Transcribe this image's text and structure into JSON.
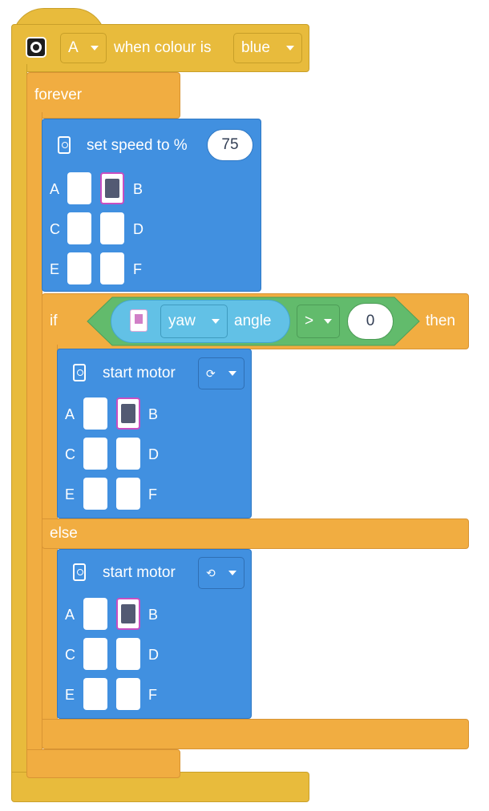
{
  "hat": {
    "port_dropdown": "A",
    "label": "when colour is",
    "colour_dropdown": "blue",
    "sensor_icon": "colour-sensor-icon"
  },
  "forever": {
    "label": "forever"
  },
  "set_speed": {
    "label": "set speed to %",
    "value": "75",
    "icon": "motor-icon",
    "ports": [
      "A",
      "B",
      "C",
      "D",
      "E",
      "F"
    ],
    "selected_port": "B"
  },
  "if_block": {
    "if_label": "if",
    "then_label": "then",
    "else_label": "else",
    "condition": {
      "hub_icon": "hub-icon",
      "axis_dropdown": "yaw",
      "angle_label": "angle",
      "operator_dropdown": ">",
      "compare_value": "0"
    }
  },
  "start_motor_1": {
    "label": "start motor",
    "direction_icon": "clockwise-icon",
    "direction_glyph": "⟳",
    "ports": [
      "A",
      "B",
      "C",
      "D",
      "E",
      "F"
    ],
    "selected_port": "B"
  },
  "start_motor_2": {
    "label": "start motor",
    "direction_icon": "counterclockwise-icon",
    "direction_glyph": "⟲",
    "ports": [
      "A",
      "B",
      "C",
      "D",
      "E",
      "F"
    ],
    "selected_port": "B"
  },
  "colors": {
    "events_yellow": "#e8bb3c",
    "control_orange": "#f1ad41",
    "motor_blue": "#4190e0",
    "operator_green": "#62bb6c",
    "sensor_lightblue": "#62c1e6"
  }
}
